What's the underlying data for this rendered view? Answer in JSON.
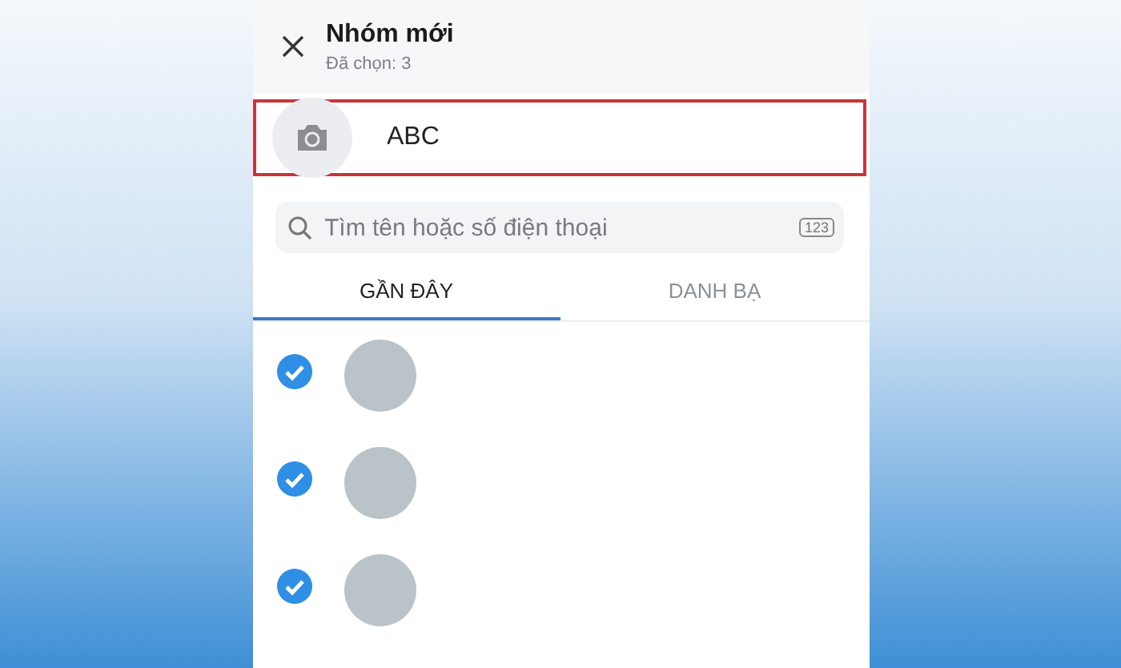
{
  "header": {
    "title": "Nhóm mới",
    "subtitle": "Đã chọn: 3"
  },
  "group_name": {
    "value": "ABC"
  },
  "search": {
    "placeholder": "Tìm tên hoặc số điện thoại",
    "keypad_label": "123"
  },
  "tabs": [
    {
      "label": "GẦN ĐÂY",
      "selected": true
    },
    {
      "label": "DANH BẠ",
      "selected": false
    }
  ],
  "contacts": [
    {
      "checked": true
    },
    {
      "checked": true
    },
    {
      "checked": true
    }
  ]
}
